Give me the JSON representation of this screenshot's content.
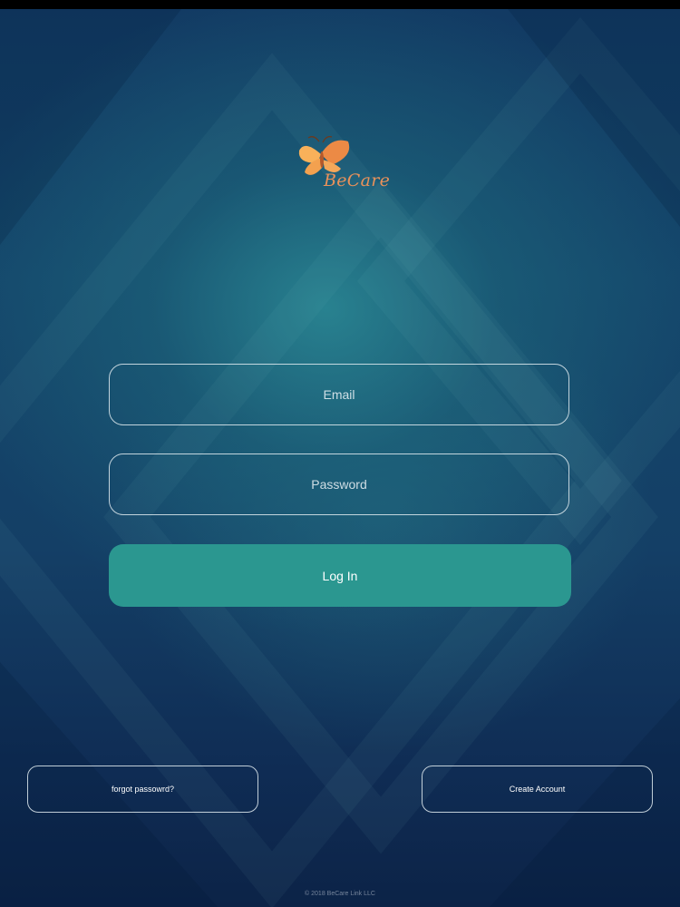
{
  "brand": {
    "name": "BeCare",
    "logo_icon": "butterfly-icon",
    "colors": {
      "wing_light": "#f8b15a",
      "wing_dark": "#ec8a45",
      "text": "#e9915a"
    }
  },
  "form": {
    "email_placeholder": "Email",
    "password_placeholder": "Password",
    "login_label": "Log In"
  },
  "links": {
    "forgot_label": "forgot passowrd?",
    "create_label": "Create Account"
  },
  "footer": {
    "copyright": "© 2018 BeCare Link LLC"
  },
  "theme": {
    "accent": "#2b9790",
    "background_dark": "#0d2240",
    "background_light": "#2c8c96",
    "border": "#e1ebf0"
  }
}
